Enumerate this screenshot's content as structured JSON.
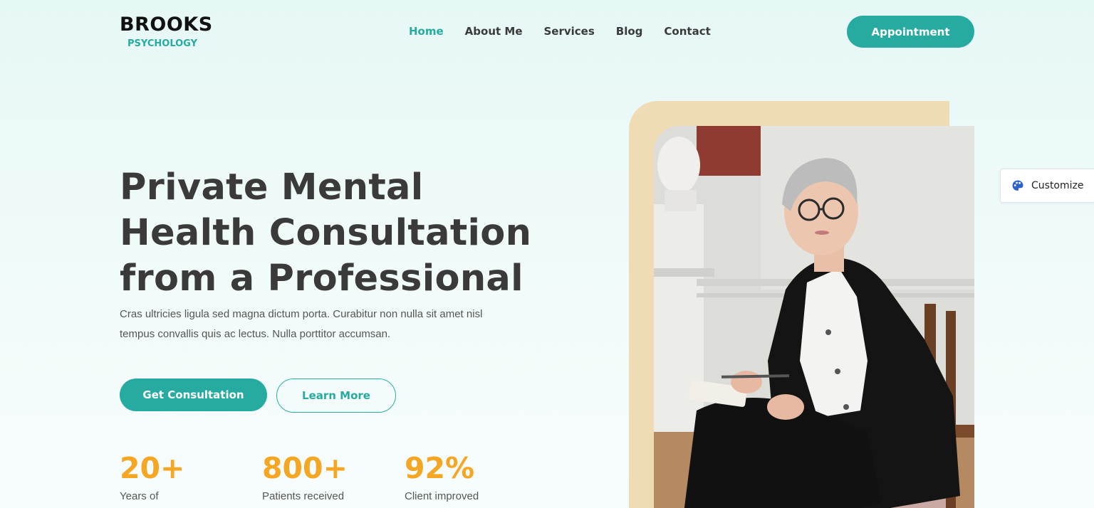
{
  "logo": {
    "main": "BROOKS",
    "sub": "PSYCHOLOGY"
  },
  "nav": {
    "items": [
      {
        "label": "Home",
        "active": true
      },
      {
        "label": "About Me",
        "active": false
      },
      {
        "label": "Services",
        "active": false
      },
      {
        "label": "Blog",
        "active": false
      },
      {
        "label": "Contact",
        "active": false
      }
    ]
  },
  "header": {
    "cta_label": "Appointment"
  },
  "hero": {
    "title_lines": [
      "Private Mental",
      "Health Consultation",
      "from a Professional"
    ],
    "description": "Cras ultricies ligula sed magna dictum porta. Curabitur non nulla sit amet nisl tempus convallis quis ac lectus. Nulla porttitor accumsan.",
    "primary_cta": "Get Consultation",
    "secondary_cta": "Learn More"
  },
  "stats": [
    {
      "value": "20+",
      "label": "Years of"
    },
    {
      "value": "800+",
      "label": "Patients received"
    },
    {
      "value": "92%",
      "label": "Client improved"
    }
  ],
  "customize": {
    "label": "Customize",
    "icon": "palette-icon"
  },
  "colors": {
    "accent": "#27aba0",
    "stat": "#f5a623",
    "frame": "#f0dcb4",
    "heading": "#3a3a3a"
  }
}
